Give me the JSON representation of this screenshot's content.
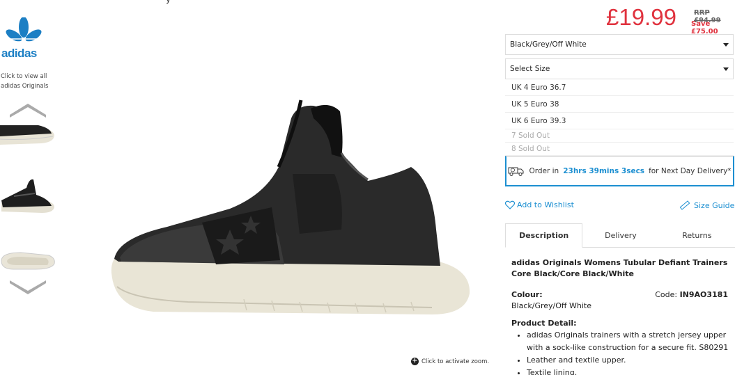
{
  "brand": {
    "name": "adidas",
    "link_text": "Click to view all adidas Originals",
    "color": "#1c7fc4"
  },
  "top_title_partial": "y",
  "price": {
    "current": "£19.99",
    "rrp": "RRP £94.99",
    "save": "Save £75.00",
    "color": "#e0323e"
  },
  "colour_select": {
    "value": "Black/Grey/Off White"
  },
  "size_select": {
    "value": "Select Size",
    "options": [
      {
        "label": "UK 4 Euro 36.7",
        "available": true
      },
      {
        "label": "UK 5 Euro 38",
        "available": true
      },
      {
        "label": "UK 6 Euro 39.3",
        "available": true
      },
      {
        "label": "7 Sold Out",
        "available": false
      },
      {
        "label": "8 Sold Out",
        "available": false
      }
    ]
  },
  "delivery": {
    "prefix": "Order in",
    "countdown": "23hrs 39mins 3secs",
    "suffix": "for Next Day Delivery*",
    "icon": "delivery-truck-icon",
    "accent": "#1c8fd1"
  },
  "actions": {
    "wishlist": "Add to Wishlist",
    "size_guide": "Size Guide"
  },
  "tabs": [
    {
      "label": "Description",
      "active": true
    },
    {
      "label": "Delivery",
      "active": false
    },
    {
      "label": "Returns",
      "active": false
    }
  ],
  "product": {
    "title": "adidas Originals Womens Tubular Defiant Trainers Core Black/Core Black/White",
    "colour_label": "Colour:",
    "colour_value": "Black/Grey/Off White",
    "code_label": "Code:",
    "code_value": "IN9AO3181",
    "detail_heading": "Product Detail:",
    "details": [
      "adidas Originals trainers with a stretch jersey upper with a sock-like construction for a secure fit. S80291",
      "Leather and textile upper.",
      "Textile lining."
    ]
  },
  "zoom_hint": "Click to activate zoom."
}
